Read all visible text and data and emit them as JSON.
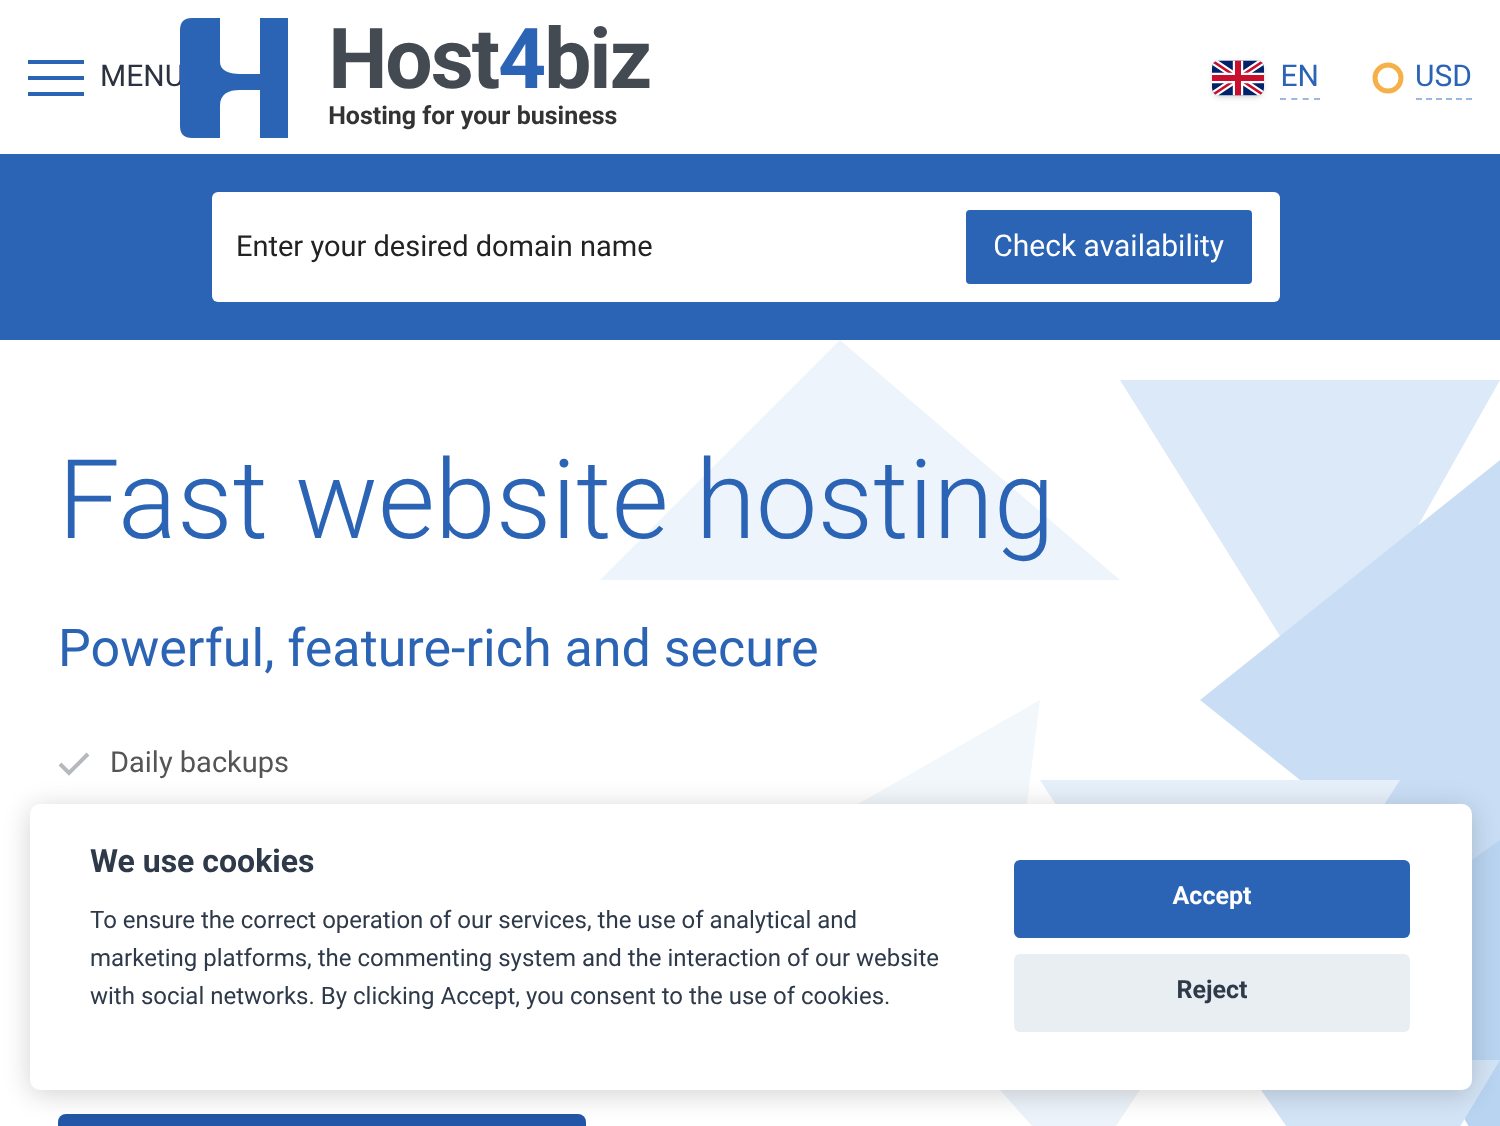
{
  "header": {
    "menu_label": "MENU",
    "logo": {
      "parts": [
        "Host",
        "4",
        "biz"
      ],
      "tagline": "Hosting for your business"
    },
    "language": "EN",
    "currency": "USD"
  },
  "domain_search": {
    "placeholder": "Enter your desired domain name",
    "button": "Check availability"
  },
  "hero": {
    "title": "Fast website hosting",
    "subtitle": "Powerful, feature-rich and secure",
    "features": [
      "Daily backups"
    ]
  },
  "cookie_banner": {
    "title": "We use cookies",
    "text": "To ensure the correct operation of our services, the use of analytical and marketing platforms, the commenting system and the interaction of our website with social networks. By clicking Accept, you consent to the use of cookies.",
    "buttons": [
      {
        "label": "Accept",
        "kind": "primary"
      },
      {
        "label": "Reject",
        "kind": "secondary"
      }
    ]
  }
}
